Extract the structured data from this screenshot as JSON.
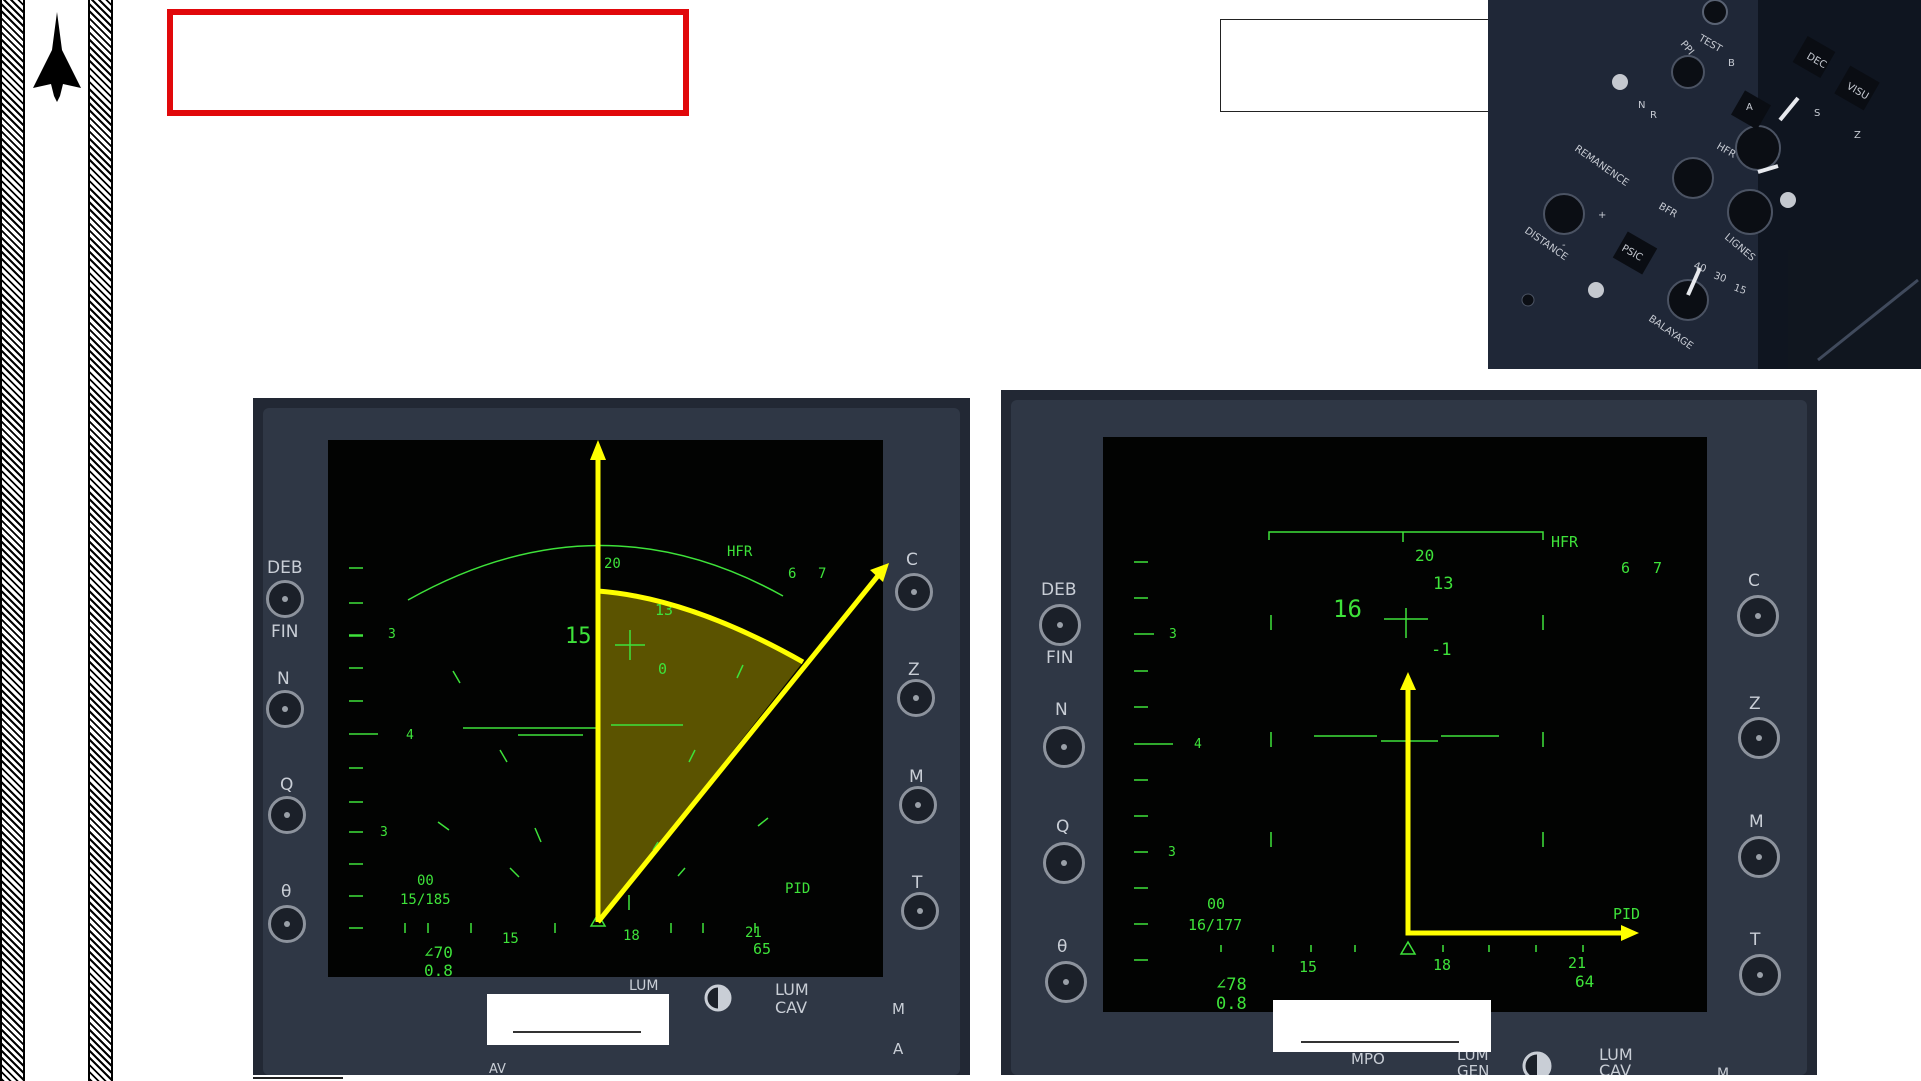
{
  "slide": {
    "title_box_text": "",
    "callout_text": ""
  },
  "panel": {
    "labels": [
      "TEST",
      "PPI",
      "B",
      "DEC",
      "VISU",
      "N",
      "R",
      "A",
      "S",
      "Z",
      "REMANENCE",
      "HFR",
      "BFR",
      "DISTANCE",
      "PSIC",
      "LIGNES",
      "BALAYAGE",
      "40",
      "30",
      "15",
      "+",
      "-"
    ]
  },
  "radar_left": {
    "side_labels_left": [
      "DEB",
      "FIN",
      "N",
      "Q",
      "θ"
    ],
    "side_labels_right": [
      "C",
      "Z",
      "M",
      "T"
    ],
    "mode": "HFR",
    "range_a": "6",
    "range_b": "7",
    "heading_top": "20",
    "value_13": "13",
    "value_15": "15",
    "value_0": "0",
    "alt_3a": "3",
    "alt_4": "4",
    "alt_3b": "3",
    "code": "00",
    "ratio": "15/185",
    "angle": "∠70",
    "mach": "0.8",
    "scale_15": "15",
    "scale_18": "18",
    "scale_21": "21",
    "scale_65": "65",
    "pid": "PID",
    "bottom_labels": [
      "LUM",
      "LUM",
      "CAV",
      "M",
      "AV",
      "A"
    ]
  },
  "radar_right": {
    "side_labels_left": [
      "DEB",
      "FIN",
      "N",
      "Q",
      "θ"
    ],
    "side_labels_right": [
      "C",
      "Z",
      "M",
      "T"
    ],
    "mode": "HFR",
    "range_a": "6",
    "range_b": "7",
    "heading_top": "20",
    "value_13": "13",
    "value_16": "16",
    "value_neg1": "-1",
    "alt_3a": "3",
    "alt_4": "4",
    "alt_3b": "3",
    "code": "00",
    "ratio": "16/177",
    "angle": "∠78",
    "mach": "0.8",
    "scale_15": "15",
    "scale_18": "18",
    "scale_21": "21",
    "scale_64": "64",
    "pid": "PID",
    "bottom_labels": [
      "MPO",
      "LUM",
      "GEN",
      "LUM",
      "CAV",
      "M"
    ]
  },
  "colors": {
    "accent_red": "#e1080b",
    "arrow_yellow": "#ffff00",
    "hud_green": "#3ee23a",
    "sector_fill": "#6b6200"
  },
  "icons": [
    "jet-silhouette-icon",
    "brightness-icon"
  ]
}
